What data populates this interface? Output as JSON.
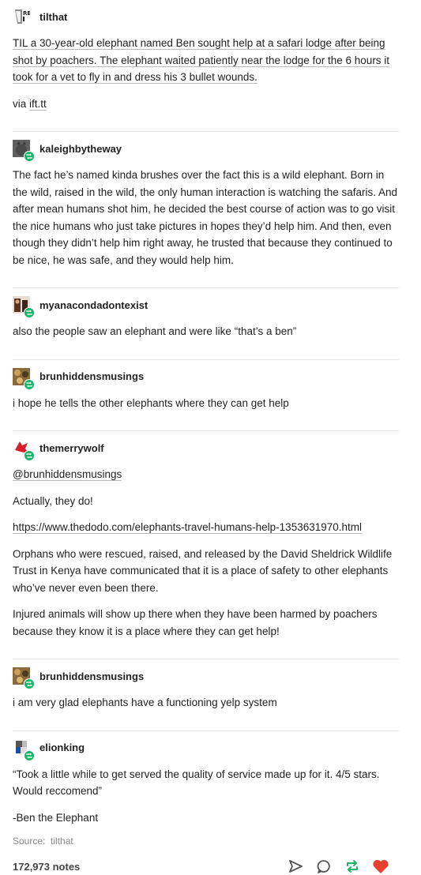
{
  "posts": [
    {
      "user": "tilthat",
      "paras": [
        "TIL a 30-year-old elephant named Ben sought help at a safari lodge after being shot by poachers. The elephant waited patiently near the lodge for the 6 hours it took for a vet to fly in and dress his 3 bullet wounds."
      ],
      "via_prefix": "via ",
      "via_link": "ift.tt"
    },
    {
      "user": "kaleighbytheway",
      "paras": [
        "The fact he’s named kinda brushes over the fact this is a wild elephant. Born in the wild, raised in the wild, the only human interaction is watching the safaris. And after mean humans shot him, he decided the best course of action was to go visit the nice humans who just take pictures in hopes they’d help him. And then, even though they didn’t help him right away, he trusted that because they continued to be nice, he was safe, and they would help him."
      ]
    },
    {
      "user": "myanacondadontexist",
      "paras": [
        "also the people saw an elephant and were like “that’s a ben”"
      ]
    },
    {
      "user": "brunhiddensmusings",
      "paras": [
        "i hope he tells the other elephants where they can get help"
      ]
    },
    {
      "user": "themerrywolf",
      "mention": "@brunhiddensmusings",
      "paras": [
        "Actually, they do!"
      ],
      "link": "https://www.thedodo.com/elephants-travel-humans-help-1353631970.html",
      "paras2": [
        "Orphans who were rescued, raised, and released by the David Sheldrick Wildlife Trust in Kenya have communicated that it is a place of safety to other elephants who’ve never even been there.",
        "Injured animals will show up there when they have been harmed by poachers because they know it is a place where they can get help!"
      ]
    },
    {
      "user": "brunhiddensmusings",
      "paras": [
        "i am very glad elephants have a functioning yelp system"
      ]
    },
    {
      "user": "elionking",
      "paras": [
        "“Took a little while to get served the quality of service made up for it. 4/5 stars. Would reccomend”",
        "-Ben the Elephant"
      ]
    }
  ],
  "source_label": "Source:",
  "source_value": "tilthat",
  "notes": "172,973 notes",
  "icons": [
    "share-icon",
    "reply-icon",
    "reblog-icon",
    "like-icon"
  ],
  "colors": {
    "reblog_green": "#16b56a",
    "like_red": "#e8402f"
  }
}
